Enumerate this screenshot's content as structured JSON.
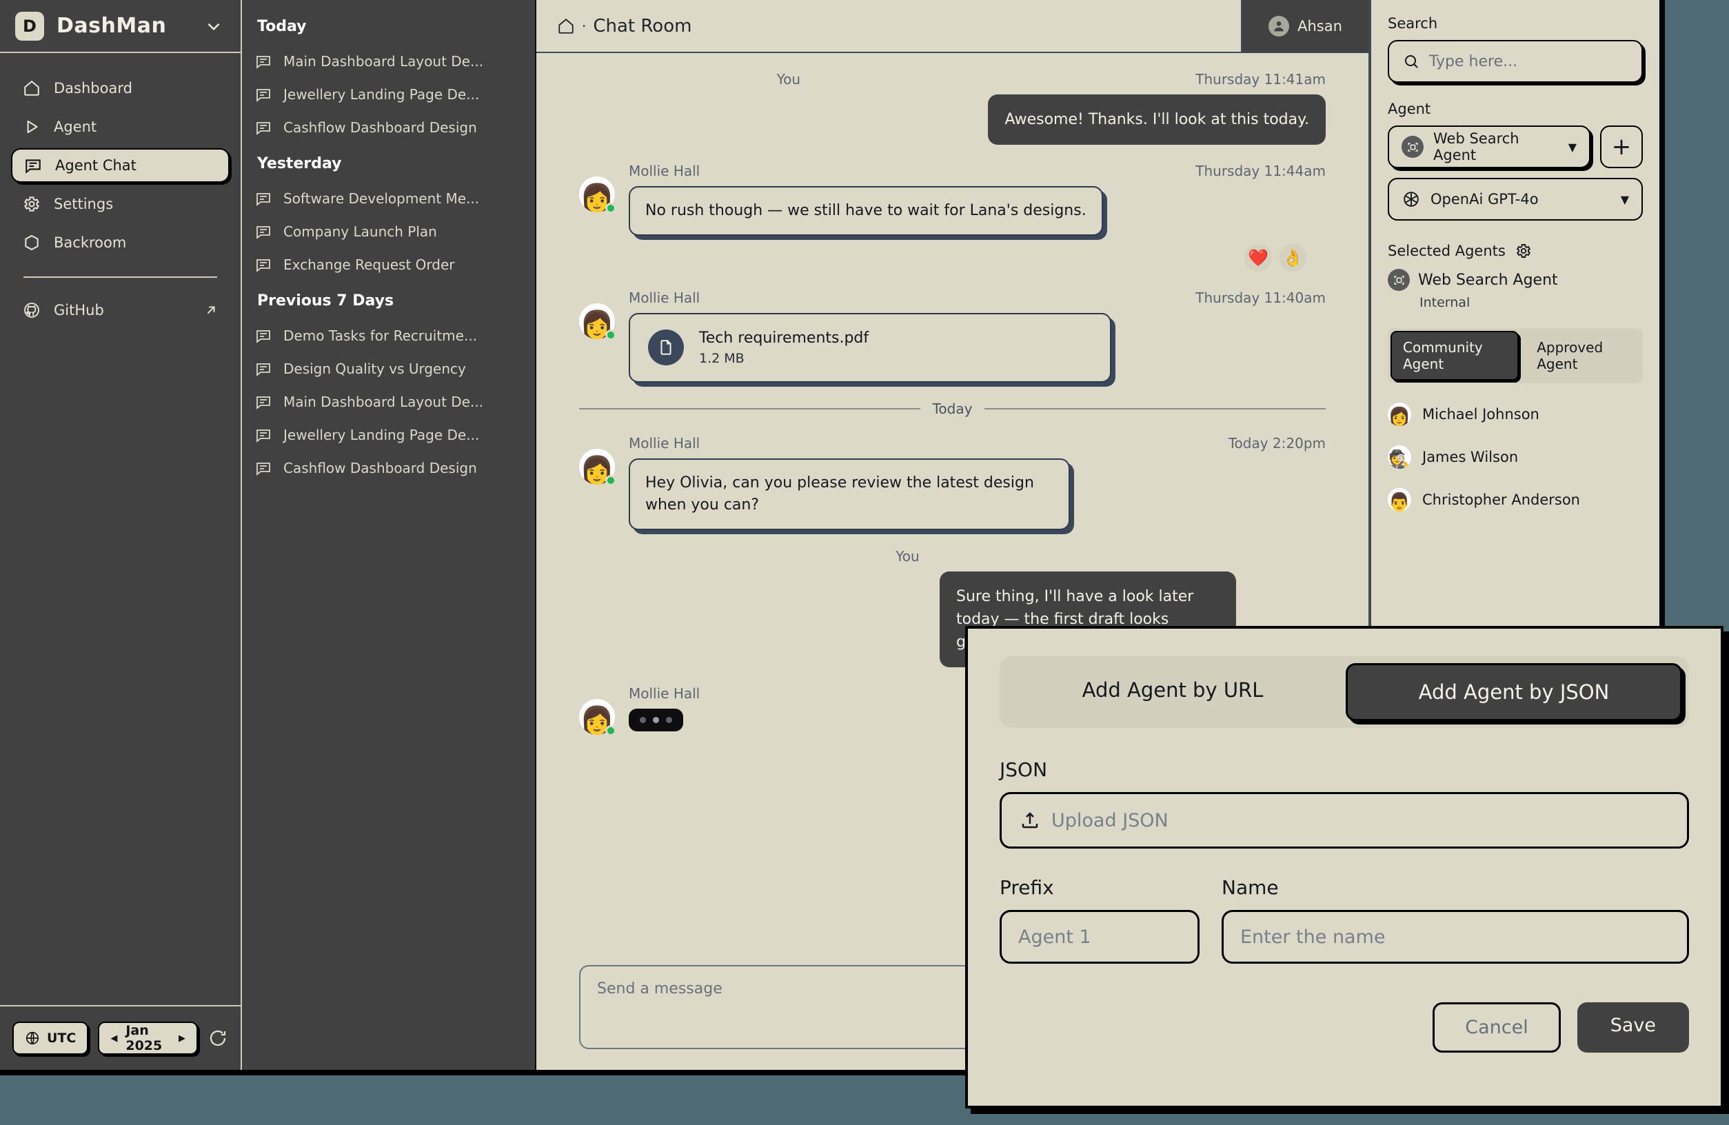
{
  "brand": {
    "logo_letter": "D",
    "name": "DashMan",
    "caret_icon": "chevron-down-icon"
  },
  "sidebar": {
    "items": [
      {
        "label": "Dashboard",
        "icon": "home-icon"
      },
      {
        "label": "Agent",
        "icon": "play-icon"
      },
      {
        "label": "Agent Chat",
        "icon": "chat-bubble-icon",
        "active": true
      },
      {
        "label": "Settings",
        "icon": "gear-icon"
      },
      {
        "label": "Backroom",
        "icon": "cube-icon"
      }
    ],
    "external": {
      "label": "GitHub",
      "icon": "github-icon",
      "arrow_icon": "arrow-up-right-icon"
    },
    "footer": {
      "timezone": "UTC",
      "timezone_icon": "globe-icon",
      "date": "Jan 2025",
      "prev_icon": "triangle-left-icon",
      "next_icon": "triangle-right-icon",
      "refresh_icon": "refresh-icon"
    }
  },
  "chat_list": {
    "groups": [
      {
        "title": "Today",
        "items": [
          "Main Dashboard Layout De...",
          "Jewellery Landing Page De...",
          "Cashflow Dashboard Design"
        ]
      },
      {
        "title": "Yesterday",
        "items": [
          "Software Development Me...",
          "Company Launch Plan",
          "Exchange Request Order"
        ]
      },
      {
        "title": "Previous 7 Days",
        "items": [
          "Demo Tasks for Recruitme...",
          "Design Quality vs Urgency",
          "Main Dashboard Layout De...",
          "Jewellery Landing Page De...",
          "Cashflow Dashboard Design"
        ]
      }
    ]
  },
  "header": {
    "home_icon": "home-icon",
    "separator": "·",
    "title": "Chat Room",
    "user": {
      "name": "Ahsan",
      "avatar_icon": "user-circle-icon"
    }
  },
  "conversation": {
    "messages": [
      {
        "sender": "You",
        "time": "Thursday 11:41am",
        "side": "out",
        "type": "text",
        "text": "Awesome! Thanks. I'll look at this today."
      },
      {
        "sender": "Mollie Hall",
        "time": "Thursday 11:44am",
        "side": "in",
        "type": "text",
        "text": "No rush though — we still have to wait for Lana's designs.",
        "reactions": [
          "❤️",
          "👌"
        ]
      },
      {
        "sender": "Mollie Hall",
        "time": "Thursday 11:40am",
        "side": "in",
        "type": "file",
        "file_name": "Tech requirements.pdf",
        "file_size": "1.2 MB",
        "file_icon": "document-icon"
      },
      {
        "divider": "Today"
      },
      {
        "sender": "Mollie Hall",
        "time": "Today 2:20pm",
        "side": "in",
        "type": "text",
        "text": "Hey Olivia, can you please review the latest design when you can?"
      },
      {
        "sender": "You",
        "time": "",
        "side": "out",
        "type": "text",
        "text": "Sure thing, I'll have a look later today — the first draft looks great!"
      },
      {
        "sender": "Mollie Hall",
        "time": "",
        "side": "in",
        "type": "typing"
      }
    ],
    "composer_placeholder": "Send a message"
  },
  "right_panel": {
    "search_label": "Search",
    "search_placeholder": "Type here...",
    "search_icon": "search-icon",
    "agent_label": "Agent",
    "agent_select": {
      "value": "Web Search Agent",
      "icon": "agent-icon",
      "caret_icon": "caret-down-icon"
    },
    "add_agent_icon": "plus-icon",
    "model_select": {
      "value": "OpenAi GPT-4o",
      "icon": "openai-icon",
      "caret_icon": "caret-down-icon"
    },
    "selected_agents_label": "Selected Agents",
    "selected_agents_gear_icon": "gear-icon",
    "selected_agent": {
      "name": "Web Search Agent",
      "sub": "Internal",
      "icon": "agent-icon"
    },
    "tabs": [
      {
        "label": "Community Agent",
        "active": true
      },
      {
        "label": "Approved Agent",
        "active": false
      }
    ],
    "people": [
      {
        "name": "Michael Johnson",
        "avatar": "👩"
      },
      {
        "name": "James Wilson",
        "avatar": "🕵"
      },
      {
        "name": "Christopher Anderson",
        "avatar": "👨"
      }
    ]
  },
  "modal": {
    "tabs": [
      {
        "label": "Add Agent by URL",
        "active": false
      },
      {
        "label": "Add Agent by JSON",
        "active": true
      }
    ],
    "json_label": "JSON",
    "upload_placeholder": "Upload JSON",
    "upload_icon": "upload-icon",
    "prefix_label": "Prefix",
    "prefix_placeholder": "Agent 1",
    "name_label": "Name",
    "name_placeholder": "Enter the name",
    "cancel_label": "Cancel",
    "save_label": "Save"
  },
  "colors": {
    "app_bg": "#dcd9c8",
    "sidebar_bg": "#414141",
    "desktop_bg": "#4e6a72",
    "bubble_shadow": "#3b475a",
    "presence_green": "#1db954"
  }
}
